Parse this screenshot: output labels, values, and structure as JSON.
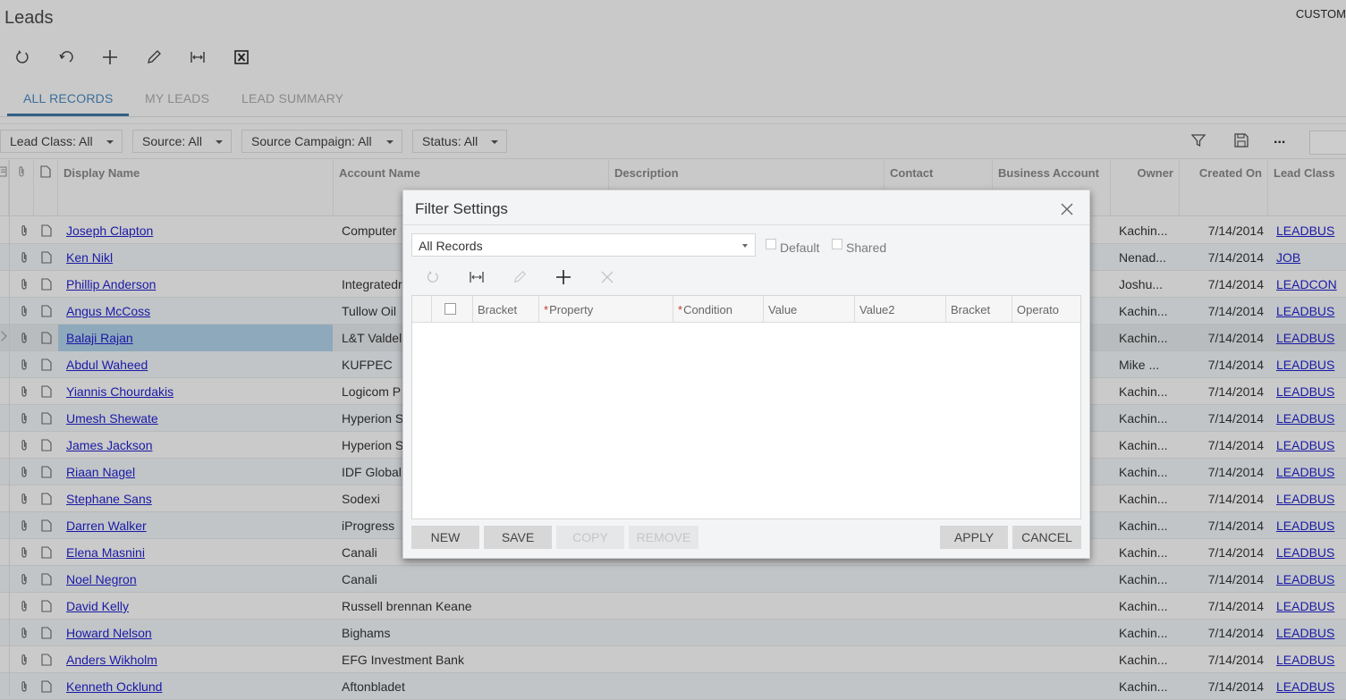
{
  "page": {
    "title": "Leads",
    "customize_label": "CUSTOM"
  },
  "toolbar": {
    "icons": [
      "refresh-icon",
      "undo-icon",
      "add-icon",
      "edit-icon",
      "fit-columns-icon",
      "excel-export-icon"
    ]
  },
  "tabs": [
    {
      "label": "ALL RECORDS",
      "active": true
    },
    {
      "label": "MY LEADS",
      "active": false
    },
    {
      "label": "LEAD SUMMARY",
      "active": false
    }
  ],
  "filters": [
    {
      "label": "Lead Class: All"
    },
    {
      "label": "Source: All"
    },
    {
      "label": "Source Campaign: All"
    },
    {
      "label": "Status: All"
    }
  ],
  "filter_toolbar": {
    "filter_icon": "funnel-icon",
    "save_icon": "save-icon",
    "more_label": "..."
  },
  "grid": {
    "columns": {
      "display_name": "Display Name",
      "account_name": "Account Name",
      "description": "Description",
      "contact": "Contact",
      "business_account": "Business Account",
      "owner": "Owner",
      "created_on": "Created On",
      "lead_class": "Lead Class"
    },
    "rows": [
      {
        "name": "Joseph Clapton",
        "account": "Computer",
        "owner": "Kachin...",
        "created": "7/14/2014",
        "class": "LEADBUS"
      },
      {
        "name": "Ken Nikl",
        "account": "",
        "owner": "Nenad...",
        "created": "7/14/2014",
        "class": "JOB"
      },
      {
        "name": "Phillip Anderson",
        "account": "Integratedr",
        "owner": "Joshu...",
        "created": "7/14/2014",
        "class": "LEADCON"
      },
      {
        "name": "Angus McCoss",
        "account": "Tullow Oil",
        "owner": "Kachin...",
        "created": "7/14/2014",
        "class": "LEADBUS"
      },
      {
        "name": "Balaji Rajan",
        "account": "L&T Valdel",
        "owner": "Kachin...",
        "created": "7/14/2014",
        "class": "LEADBUS",
        "selected": true
      },
      {
        "name": "Abdul Waheed",
        "account": "KUFPEC",
        "owner": "Mike ...",
        "created": "7/14/2014",
        "class": "LEADBUS"
      },
      {
        "name": "Yiannis Chourdakis",
        "account": "Logicom P",
        "owner": "Kachin...",
        "created": "7/14/2014",
        "class": "LEADBUS"
      },
      {
        "name": "Umesh Shewate",
        "account": "Hyperion S",
        "owner": "Kachin...",
        "created": "7/14/2014",
        "class": "LEADBUS"
      },
      {
        "name": "James Jackson",
        "account": "Hyperion S",
        "owner": "Kachin...",
        "created": "7/14/2014",
        "class": "LEADBUS"
      },
      {
        "name": "Riaan Nagel",
        "account": "IDF Global",
        "owner": "Kachin...",
        "created": "7/14/2014",
        "class": "LEADBUS"
      },
      {
        "name": "Stephane Sans",
        "account": "Sodexi",
        "owner": "Kachin...",
        "created": "7/14/2014",
        "class": "LEADBUS"
      },
      {
        "name": "Darren Walker",
        "account": "iProgress",
        "owner": "Kachin...",
        "created": "7/14/2014",
        "class": "LEADBUS"
      },
      {
        "name": "Elena Masnini",
        "account": "Canali",
        "owner": "Kachin...",
        "created": "7/14/2014",
        "class": "LEADBUS"
      },
      {
        "name": "Noel Negron",
        "account": "Canali",
        "owner": "Kachin...",
        "created": "7/14/2014",
        "class": "LEADBUS"
      },
      {
        "name": "David Kelly",
        "account": "Russell brennan Keane",
        "owner": "Kachin...",
        "created": "7/14/2014",
        "class": "LEADBUS"
      },
      {
        "name": "Howard Nelson",
        "account": "Bighams",
        "owner": "Kachin...",
        "created": "7/14/2014",
        "class": "LEADBUS"
      },
      {
        "name": "Anders Wikholm",
        "account": "EFG Investment Bank",
        "owner": "Kachin...",
        "created": "7/14/2014",
        "class": "LEADBUS"
      },
      {
        "name": "Kenneth Ocklund",
        "account": "Aftonbladet",
        "owner": "Kachin...",
        "created": "7/14/2014",
        "class": "LEADBUS"
      }
    ]
  },
  "dialog": {
    "title": "Filter Settings",
    "selected_filter": "All Records",
    "default_label": "Default",
    "default_checked": false,
    "shared_label": "Shared",
    "shared_checked": false,
    "columns": {
      "bracket_open": "Bracket",
      "property": "Property",
      "condition": "Condition",
      "value": "Value",
      "value2": "Value2",
      "bracket_close": "Bracket",
      "operator": "Operato"
    },
    "required_mark": "*",
    "buttons": {
      "new": "NEW",
      "save": "SAVE",
      "copy": "COPY",
      "remove": "REMOVE",
      "apply": "APPLY",
      "cancel": "CANCEL"
    }
  }
}
